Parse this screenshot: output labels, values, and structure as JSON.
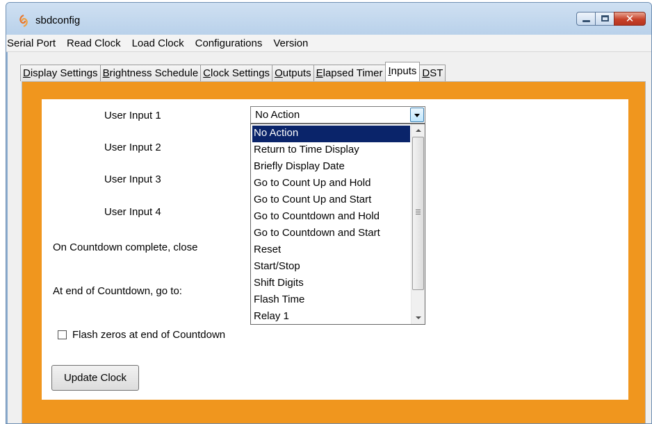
{
  "window": {
    "title": "sbdconfig",
    "icon": "app-logo-icon",
    "controls": {
      "minimize": "minimize-icon",
      "maximize": "maximize-icon",
      "close": "✕"
    }
  },
  "menu": [
    "Serial Port",
    "Read Clock",
    "Load Clock",
    "Configurations",
    "Version"
  ],
  "tabs": [
    {
      "label": "Display Settings",
      "mnemonic": "D",
      "rest": "isplay Settings"
    },
    {
      "label": "Brightness Schedule",
      "mnemonic": "B",
      "rest": "rightness Schedule"
    },
    {
      "label": "Clock Settings",
      "mnemonic": "C",
      "rest": "lock Settings"
    },
    {
      "label": "Outputs",
      "mnemonic": "O",
      "rest": "utputs"
    },
    {
      "label": "Elapsed Timer",
      "mnemonic": "E",
      "rest": "lapsed Timer"
    },
    {
      "label": "Inputs",
      "mnemonic": "I",
      "rest": "nputs"
    },
    {
      "label": "DST",
      "mnemonic": "D",
      "rest": "ST"
    }
  ],
  "active_tab": "Inputs",
  "accent_color": "#f0961e",
  "labels": {
    "user_input_1": "User Input 1",
    "user_input_2": "User Input 2",
    "user_input_3": "User Input 3",
    "user_input_4": "User Input 4",
    "countdown_close": "On Countdown complete, close",
    "countdown_goto": "At end of Countdown, go to:",
    "flash_zeros": "Flash zeros at end of Countdown"
  },
  "combo": {
    "selected": "No Action",
    "options": [
      "No Action",
      "Return to Time Display",
      "Briefly Display Date",
      "Go to Count Up and Hold",
      "Go to Count Up and Start",
      "Go to Countdown and Hold",
      "Go to Countdown and Start",
      "Reset",
      "Start/Stop",
      "Shift Digits",
      "Flash Time",
      "Relay 1"
    ]
  },
  "flash_zeros_checked": false,
  "button": {
    "update_clock": "Update Clock"
  }
}
